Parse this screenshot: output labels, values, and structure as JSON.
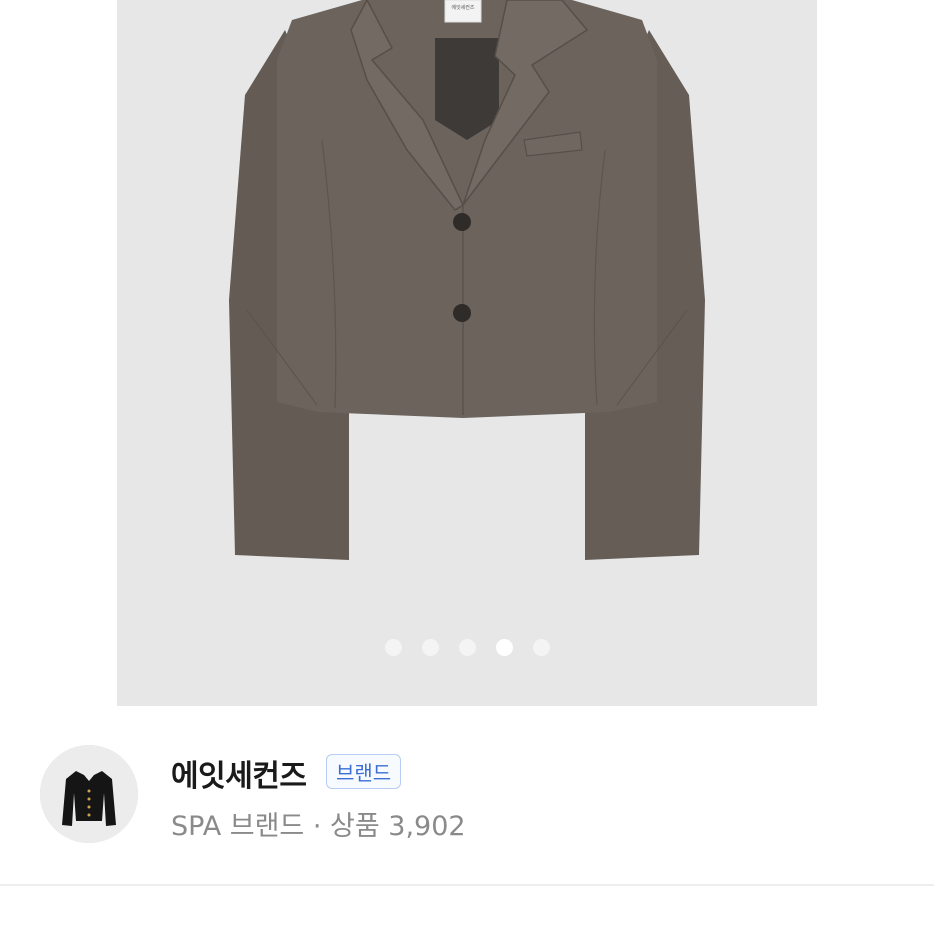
{
  "gallery": {
    "slide_count": 5,
    "active_index": 3,
    "tag_text": "에잇세컨즈"
  },
  "brand": {
    "name": "에잇세컨즈",
    "badge_label": "브랜드",
    "meta": "SPA 브랜드 · 상품 3,902",
    "avatar_icon": "jacket-thumbnail-icon"
  },
  "colors": {
    "jacket": "#675f58",
    "gallery_bg": "#e7e7e8",
    "badge_text": "#3b6fd6",
    "badge_border": "#b7cdf1",
    "meta_text": "#8a8a8a"
  }
}
